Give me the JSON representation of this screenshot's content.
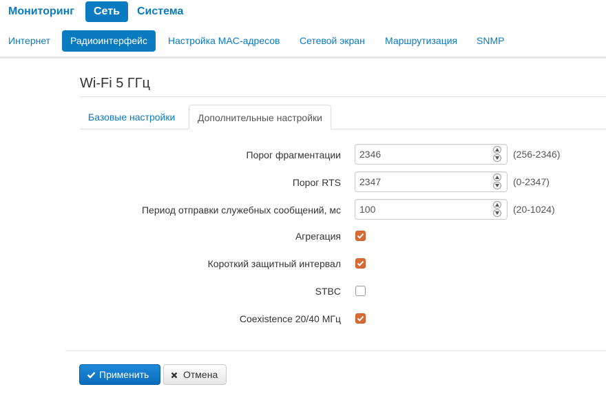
{
  "top_nav": {
    "items": [
      {
        "label": "Мониторинг",
        "active": false
      },
      {
        "label": "Сеть",
        "active": true
      },
      {
        "label": "Система",
        "active": false
      }
    ]
  },
  "sub_nav": {
    "items": [
      {
        "label": "Интернет",
        "active": false
      },
      {
        "label": "Радиоинтерфейс",
        "active": true
      },
      {
        "label": "Настройка MAC-адресов",
        "active": false
      },
      {
        "label": "Сетевой экран",
        "active": false
      },
      {
        "label": "Маршрутизация",
        "active": false
      },
      {
        "label": "SNMP",
        "active": false
      }
    ]
  },
  "section": {
    "title": "Wi-Fi 5 ГГц"
  },
  "tabs": [
    {
      "label": "Базовые настройки",
      "active": false
    },
    {
      "label": "Дополнительные настройки",
      "active": true
    }
  ],
  "form": {
    "fragmentation": {
      "label": "Порог фрагментации",
      "value": "2346",
      "range": "(256-2346)"
    },
    "rts": {
      "label": "Порог RTS",
      "value": "2347",
      "range": "(0-2347)"
    },
    "beacon": {
      "label": "Период отправки служебных сообщений, мс",
      "value": "100",
      "range": "(20-1024)"
    },
    "aggregation": {
      "label": "Агрегация",
      "checked": true
    },
    "short_gi": {
      "label": "Короткий защитный интервал",
      "checked": true
    },
    "stbc": {
      "label": "STBC",
      "checked": false
    },
    "coexistence": {
      "label": "Coexistence 20/40 МГц",
      "checked": true
    }
  },
  "buttons": {
    "apply": {
      "label": "Применить",
      "icon": "check-icon"
    },
    "cancel": {
      "label": "Отмена",
      "icon": "cross-icon"
    }
  },
  "colors": {
    "accent": "#0a7bc1",
    "checkbox_checked": "#d76b35",
    "primary_button": "#0a6cbe"
  }
}
